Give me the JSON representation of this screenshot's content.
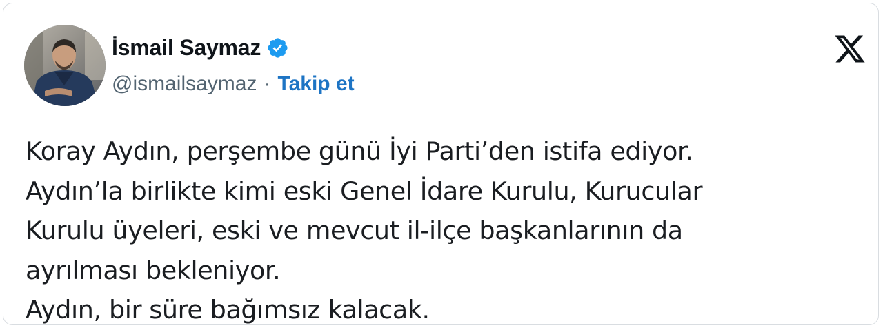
{
  "author": {
    "display_name": "İsmail Saymaz",
    "handle": "@ismailsaymaz",
    "separator": "·",
    "follow_label": "Takip et",
    "verified": true,
    "avatar_icon": "profile-photo"
  },
  "platform_icon": "x-logo-icon",
  "tweet": {
    "lines": [
      "Koray Aydın, perşembe günü İyi Parti’den istifa ediyor.",
      "Aydın’la birlikte kimi eski Genel İdare Kurulu, Kurucular",
      "Kurulu üyeleri, eski ve mevcut il-ilçe başkanlarının da",
      "ayrılması bekleniyor.",
      "Aydın, bir süre bağımsız kalacak."
    ]
  },
  "colors": {
    "link": "#1d74c4",
    "verified_badge": "#1d9bf0",
    "muted_text": "#536471",
    "main_text": "#0f1419"
  }
}
